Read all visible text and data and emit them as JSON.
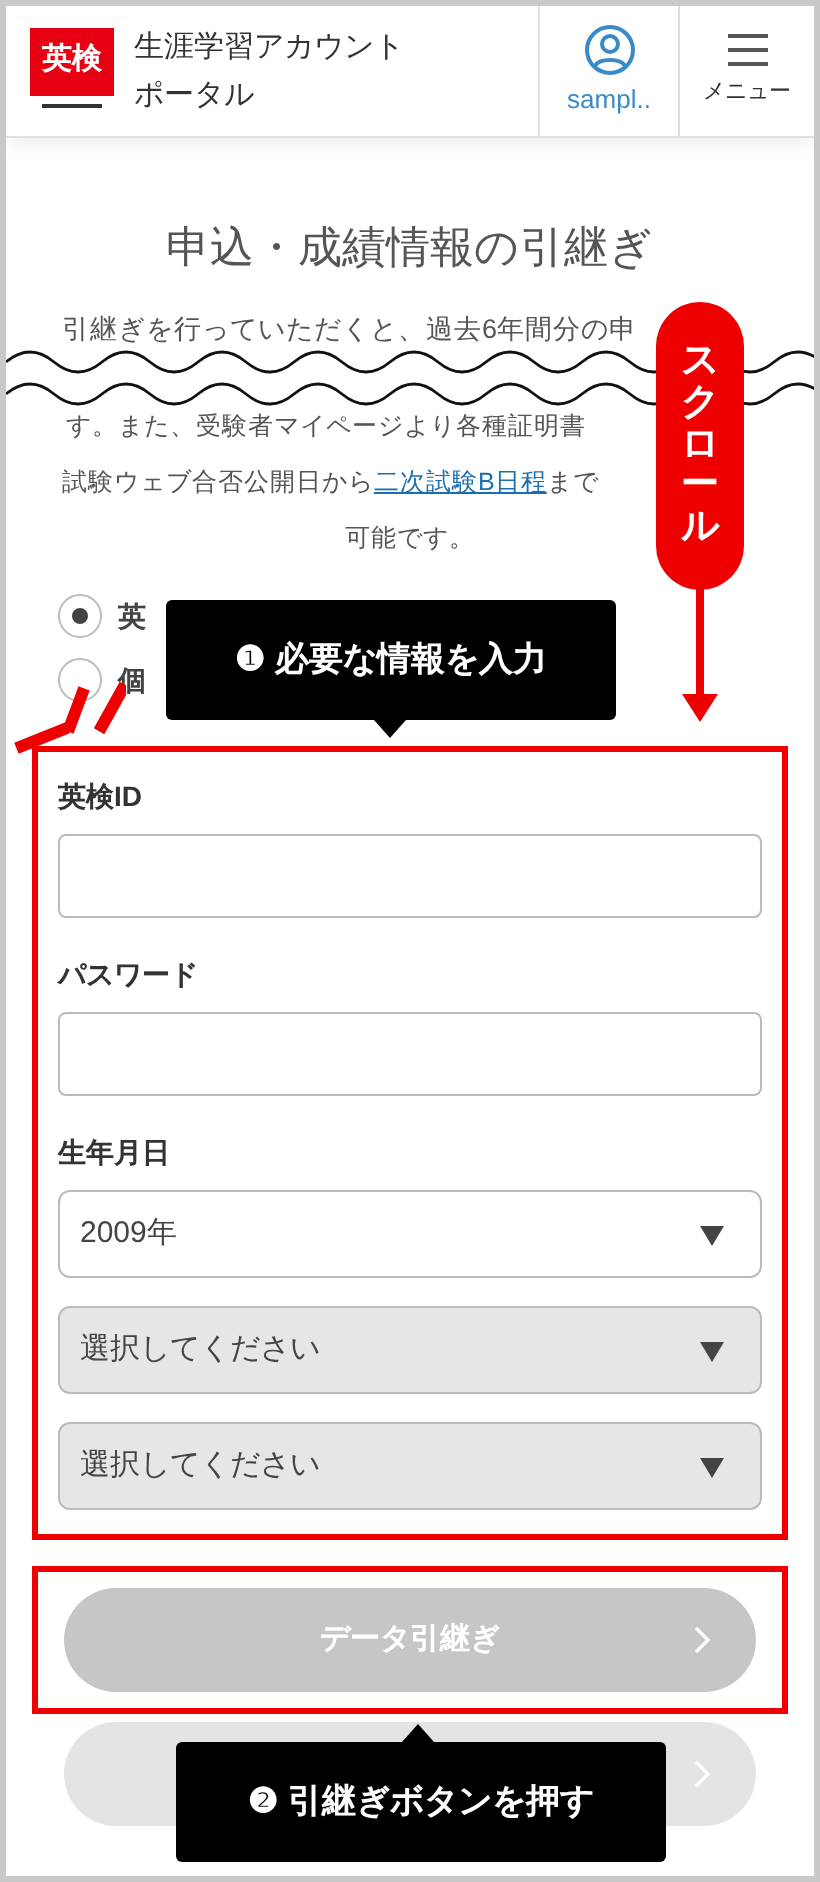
{
  "header": {
    "logo": "英検",
    "title_lines": [
      "生涯学習アカウント",
      "ポータル"
    ],
    "user_label": "sampl..",
    "menu_label": "メニュー"
  },
  "page_title": "申込・成績情報の引継ぎ",
  "intro": {
    "first_line": "引継ぎを行っていただくと、過去6年間分の申",
    "third_line": "す。また、受験者マイページより各種証明書",
    "fourth_before": "試験ウェブ合否公開日から",
    "fourth_link": "二次試験B日程",
    "fourth_after": "まで",
    "last_line": "可能です。"
  },
  "radios": [
    {
      "label": "英",
      "selected": true
    },
    {
      "label": "個",
      "selected": false
    }
  ],
  "form": {
    "fields": [
      {
        "kind": "input",
        "label": "英検ID"
      },
      {
        "kind": "input",
        "label": "パスワード"
      }
    ],
    "birth_label": "生年月日",
    "selects": [
      {
        "value": "2009年",
        "filled": true
      },
      {
        "value": "選択してください",
        "filled": false
      },
      {
        "value": "選択してください",
        "filled": false
      }
    ]
  },
  "primary_button": {
    "label": "データ引継ぎ",
    "disabled": true
  },
  "annotations": {
    "scroll_label": "スクロール",
    "step1": "❶ 必要な情報を入力",
    "step2": "❷ 引継ぎボタンを押す"
  }
}
